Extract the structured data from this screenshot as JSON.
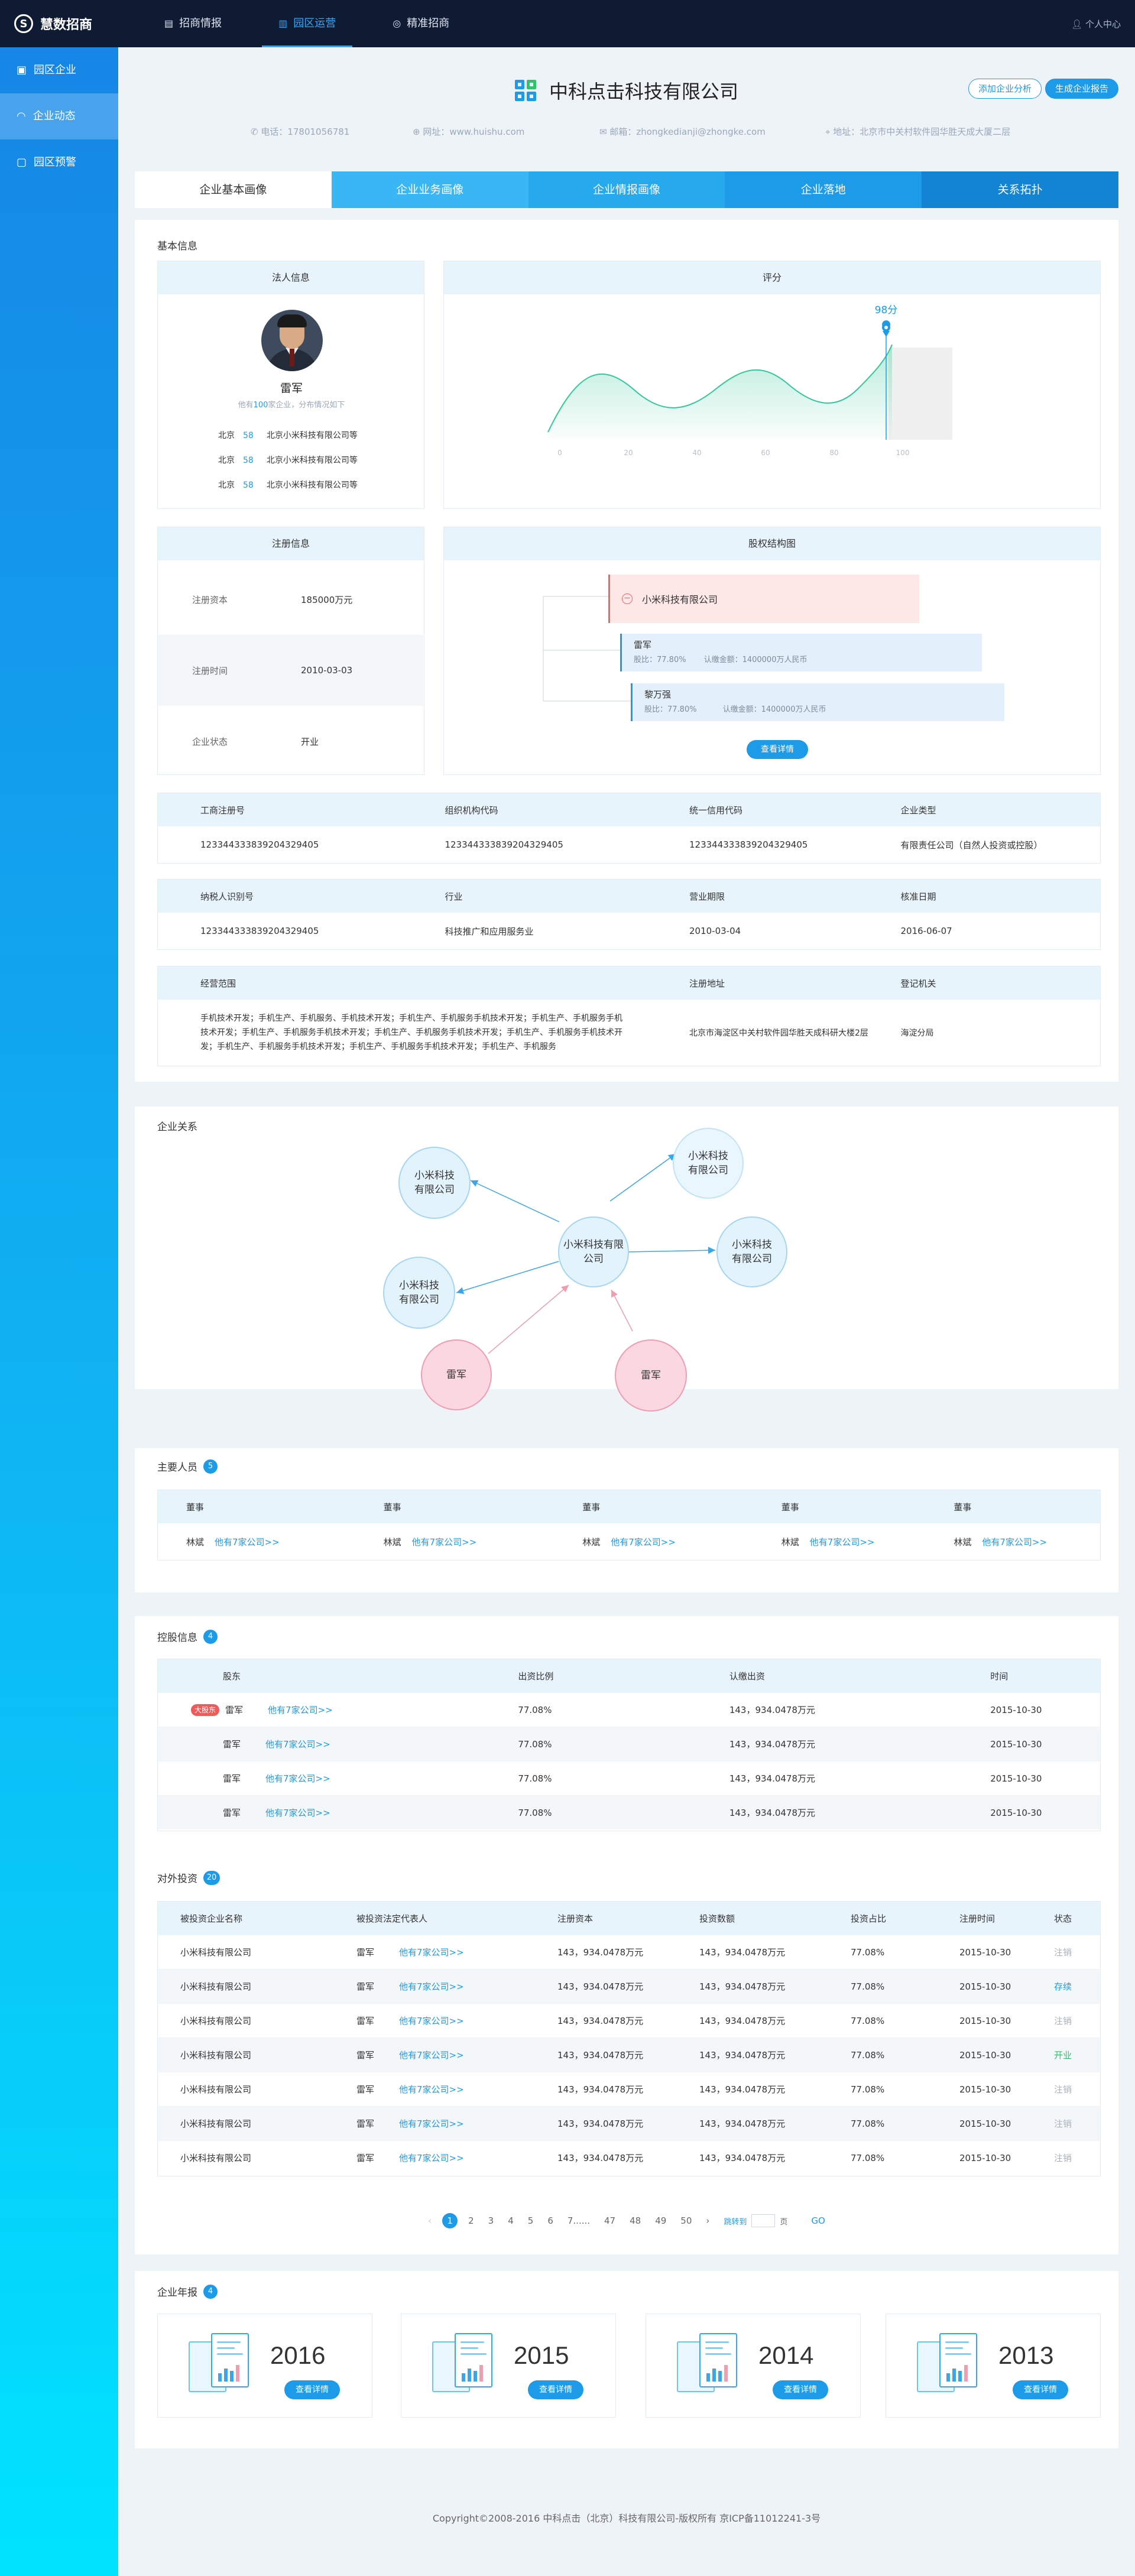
{
  "topbar": {
    "logo": "慧数招商",
    "nav": [
      {
        "label": "招商情报",
        "icon": "clipboard-icon"
      },
      {
        "label": "园区运营",
        "icon": "bar-chart-icon"
      },
      {
        "label": "精准招商",
        "icon": "target-icon"
      }
    ],
    "user": "个人中心"
  },
  "sidebar": {
    "items": [
      {
        "label": "园区企业",
        "icon": "building-icon"
      },
      {
        "label": "企业动态",
        "icon": "wave-icon"
      },
      {
        "label": "园区预警",
        "icon": "alert-icon"
      }
    ]
  },
  "company": {
    "name": "中科点击科技有限公司",
    "btn_analysis": "添加企业分析",
    "btn_report": "生成企业报告",
    "phone": "电话：17801056781",
    "website": "网址：www.huishu.com",
    "email": "邮箱：zhongkedianji@zhongke.com",
    "address": "地址：北京市中关村软件园华胜天成大厦二层"
  },
  "tabs": [
    "企业基本画像",
    "企业业务画像",
    "企业情报画像",
    "企业落地",
    "关系拓扑"
  ],
  "basic": {
    "title": "基本信息",
    "legal_head": "法人信息",
    "person_name": "雷军",
    "person_sub_pre": "他有",
    "person_sub_count": "100",
    "person_sub_post": "家企业，分布情况如下",
    "person_rows": [
      {
        "city": "北京",
        "num": "58",
        "company": "北京小米科技有限公司等"
      },
      {
        "city": "北京",
        "num": "58",
        "company": "北京小米科技有限公司等"
      },
      {
        "city": "北京",
        "num": "58",
        "company": "北京小米科技有限公司等"
      }
    ],
    "score_head": "评分",
    "score_label": "98分",
    "score_ticks": [
      "0",
      "20",
      "40",
      "60",
      "80",
      "100"
    ],
    "reg_head": "注册信息",
    "reg_rows": [
      {
        "k": "注册资本",
        "v": "185000万元"
      },
      {
        "k": "注册时间",
        "v": "2010-03-03"
      },
      {
        "k": "企业状态",
        "v": "开业"
      }
    ],
    "equity_head": "股权结构图",
    "equity_root": "小米科技有限公司",
    "equity_children": [
      {
        "name": "雷军",
        "ratio": "股比：77.80%",
        "capital": "认缴金额：1400000万人民币"
      },
      {
        "name": "黎万强",
        "ratio": "股比：77.80%",
        "capital": "认缴金额：1400000万人民币"
      }
    ],
    "equity_btn": "查看详情",
    "grid1_heads": [
      "工商注册号",
      "组织机构代码",
      "统一信用代码",
      "企业类型"
    ],
    "grid1_vals": [
      "1233443338392043294​05",
      "1233443338392043294​05",
      "1233443338392043294​05",
      "有限责任公司（自然人投资或控股）"
    ],
    "grid2_heads": [
      "纳税人识别号",
      "行业",
      "营业期限",
      "核准日期"
    ],
    "grid2_vals": [
      "1233443338392043294​05",
      "科技推广和应用服务业",
      "2010-03-04",
      "2016-06-07"
    ],
    "grid3_heads": [
      "经营范围",
      "注册地址",
      "登记机关"
    ],
    "grid3_scope": "手机技术开发；手机生产、手机服务、手机技术开发；手机生产、手机服务手机技术开发；手机生产、手机服务手机技术开发；手机生产、手机服务手机技术开发；手机生产、手机服务手机技术开发；手机生产、手机服务手机技术开发；手机生产、手机服务手机技术开发；手机生产、手机服务手机技术开发；手机生产、手机服务",
    "grid3_address": "北京市海淀区中关村软件园华胜天成科研大楼2层",
    "grid3_authority": "海淀分局"
  },
  "relations": {
    "title": "企业关系",
    "center": "小米科技有限公司",
    "nodes": [
      "小米科技有限公司",
      "小米科技有限公司",
      "小米科技有限公司",
      "小米科技有限公司",
      "雷军",
      "雷军"
    ]
  },
  "people": {
    "title": "主要人员",
    "count": "5",
    "items": [
      {
        "role": "董事",
        "name": "林斌",
        "link": "他有7家公司>>"
      },
      {
        "role": "董事",
        "name": "林斌",
        "link": "他有7家公司>>"
      },
      {
        "role": "董事",
        "name": "林斌",
        "link": "他有7家公司>>"
      },
      {
        "role": "董事",
        "name": "林斌",
        "link": "他有7家公司>>"
      },
      {
        "role": "董事",
        "name": "林斌",
        "link": "他有7家公司>>"
      }
    ]
  },
  "shareholders": {
    "title": "控股信息",
    "count": "4",
    "heads": [
      "股东",
      "出资比例",
      "认缴出资",
      "时间"
    ],
    "major_tag": "大股东",
    "rows": [
      {
        "name": "雷军",
        "link": "他有7家公司>>",
        "ratio": "77.08%",
        "amount": "143，934.0478万元",
        "date": "2015-10-30"
      },
      {
        "name": "雷军",
        "link": "他有7家公司>>",
        "ratio": "77.08%",
        "amount": "143，934.0478万元",
        "date": "2015-10-30"
      },
      {
        "name": "雷军",
        "link": "他有7家公司>>",
        "ratio": "77.08%",
        "amount": "143，934.0478万元",
        "date": "2015-10-30"
      },
      {
        "name": "雷军",
        "link": "他有7家公司>>",
        "ratio": "77.08%",
        "amount": "143，934.0478万元",
        "date": "2015-10-30"
      }
    ]
  },
  "investments": {
    "title": "对外投资",
    "count": "20",
    "heads": [
      "被投资企业名称",
      "被投资法定代表人",
      "注册资本",
      "投资数额",
      "投资占比",
      "注册时间",
      "状态"
    ],
    "rows": [
      {
        "company": "小米科技有限公司",
        "person": "雷军",
        "link": "他有7家公司>>",
        "capital": "143，934.0478万元",
        "amount": "143，934.0478万元",
        "ratio": "77.08%",
        "date": "2015-10-30",
        "status": "注销"
      },
      {
        "company": "小米科技有限公司",
        "person": "雷军",
        "link": "他有7家公司>>",
        "capital": "143，934.0478万元",
        "amount": "143，934.0478万元",
        "ratio": "77.08%",
        "date": "2015-10-30",
        "status": "存续"
      },
      {
        "company": "小米科技有限公司",
        "person": "雷军",
        "link": "他有7家公司>>",
        "capital": "143，934.0478万元",
        "amount": "143，934.0478万元",
        "ratio": "77.08%",
        "date": "2015-10-30",
        "status": "注销"
      },
      {
        "company": "小米科技有限公司",
        "person": "雷军",
        "link": "他有7家公司>>",
        "capital": "143，934.0478万元",
        "amount": "143，934.0478万元",
        "ratio": "77.08%",
        "date": "2015-10-30",
        "status": "开业"
      },
      {
        "company": "小米科技有限公司",
        "person": "雷军",
        "link": "他有7家公司>>",
        "capital": "143，934.0478万元",
        "amount": "143，934.0478万元",
        "ratio": "77.08%",
        "date": "2015-10-30",
        "status": "注销"
      },
      {
        "company": "小米科技有限公司",
        "person": "雷军",
        "link": "他有7家公司>>",
        "capital": "143，934.0478万元",
        "amount": "143，934.0478万元",
        "ratio": "77.08%",
        "date": "2015-10-30",
        "status": "注销"
      },
      {
        "company": "小米科技有限公司",
        "person": "雷军",
        "link": "他有7家公司>>",
        "capital": "143，934.0478万元",
        "amount": "143，934.0478万元",
        "ratio": "77.08%",
        "date": "2015-10-30",
        "status": "注销"
      }
    ],
    "pager": {
      "pages": [
        "1",
        "2",
        "3",
        "4",
        "5",
        "6",
        "7......",
        "47",
        "48",
        "49",
        "50"
      ],
      "jump": "跳转到",
      "unit": "页",
      "go": "GO"
    }
  },
  "reports": {
    "title": "企业年报",
    "count": "4",
    "btn": "查看详情",
    "years": [
      "2016",
      "2015",
      "2014",
      "2013"
    ]
  },
  "footer": "Copyright©2008-2016 中科点击（北京）科技有限公司-版权所有  京ICP备11012241-3号"
}
